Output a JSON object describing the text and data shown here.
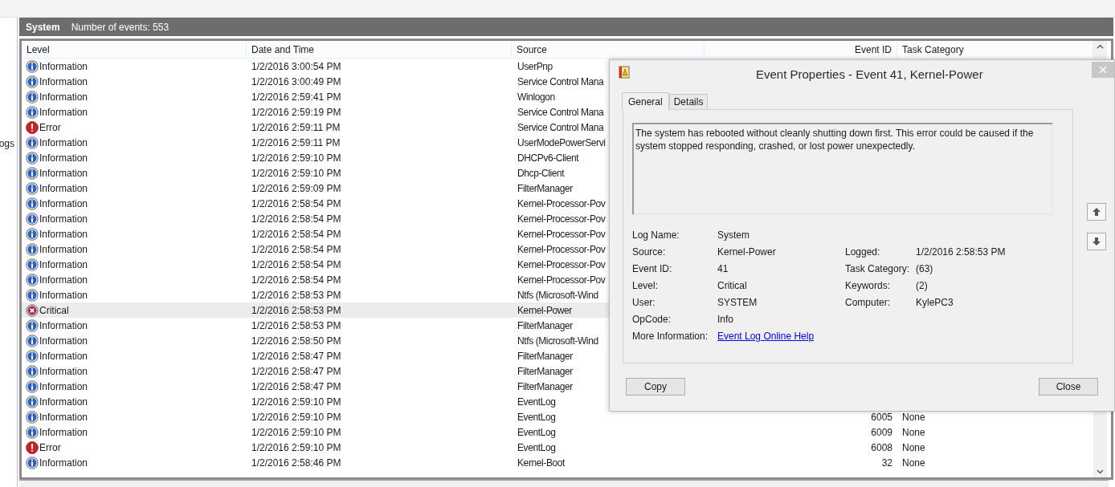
{
  "sidebar": {
    "partial_text": "ogs"
  },
  "panel": {
    "title": "System",
    "count": "Number of events: 553"
  },
  "table": {
    "columns": [
      "Level",
      "Date and Time",
      "Source",
      "Event ID",
      "Task Category"
    ],
    "rows": [
      {
        "kind": "info",
        "level": "Information",
        "date": "1/2/2016 3:00:54 PM",
        "source": "UserPnp",
        "selected": false
      },
      {
        "kind": "info",
        "level": "Information",
        "date": "1/2/2016 3:00:49 PM",
        "source": "Service Control Mana",
        "selected": false
      },
      {
        "kind": "info",
        "level": "Information",
        "date": "1/2/2016 2:59:41 PM",
        "source": "Winlogon",
        "selected": false
      },
      {
        "kind": "info",
        "level": "Information",
        "date": "1/2/2016 2:59:19 PM",
        "source": "Service Control Mana",
        "selected": false
      },
      {
        "kind": "error",
        "level": "Error",
        "date": "1/2/2016 2:59:11 PM",
        "source": "Service Control Mana",
        "selected": false
      },
      {
        "kind": "info",
        "level": "Information",
        "date": "1/2/2016 2:59:11 PM",
        "source": "UserModePowerServi",
        "selected": false
      },
      {
        "kind": "info",
        "level": "Information",
        "date": "1/2/2016 2:59:10 PM",
        "source": "DHCPv6-Client",
        "selected": false
      },
      {
        "kind": "info",
        "level": "Information",
        "date": "1/2/2016 2:59:10 PM",
        "source": "Dhcp-Client",
        "selected": false
      },
      {
        "kind": "info",
        "level": "Information",
        "date": "1/2/2016 2:59:09 PM",
        "source": "FilterManager",
        "selected": false
      },
      {
        "kind": "info",
        "level": "Information",
        "date": "1/2/2016 2:58:54 PM",
        "source": "Kernel-Processor-Pov",
        "selected": false
      },
      {
        "kind": "info",
        "level": "Information",
        "date": "1/2/2016 2:58:54 PM",
        "source": "Kernel-Processor-Pov",
        "selected": false
      },
      {
        "kind": "info",
        "level": "Information",
        "date": "1/2/2016 2:58:54 PM",
        "source": "Kernel-Processor-Pov",
        "selected": false
      },
      {
        "kind": "info",
        "level": "Information",
        "date": "1/2/2016 2:58:54 PM",
        "source": "Kernel-Processor-Pov",
        "selected": false
      },
      {
        "kind": "info",
        "level": "Information",
        "date": "1/2/2016 2:58:54 PM",
        "source": "Kernel-Processor-Pov",
        "selected": false
      },
      {
        "kind": "info",
        "level": "Information",
        "date": "1/2/2016 2:58:54 PM",
        "source": "Kernel-Processor-Pov",
        "selected": false
      },
      {
        "kind": "info",
        "level": "Information",
        "date": "1/2/2016 2:58:53 PM",
        "source": "Ntfs (Microsoft-Wind",
        "selected": false
      },
      {
        "kind": "critical",
        "level": "Critical",
        "date": "1/2/2016 2:58:53 PM",
        "source": "Kernel-Power",
        "selected": true
      },
      {
        "kind": "info",
        "level": "Information",
        "date": "1/2/2016 2:58:53 PM",
        "source": "FilterManager",
        "selected": false
      },
      {
        "kind": "info",
        "level": "Information",
        "date": "1/2/2016 2:58:50 PM",
        "source": "Ntfs (Microsoft-Wind",
        "selected": false
      },
      {
        "kind": "info",
        "level": "Information",
        "date": "1/2/2016 2:58:47 PM",
        "source": "FilterManager",
        "selected": false
      },
      {
        "kind": "info",
        "level": "Information",
        "date": "1/2/2016 2:58:47 PM",
        "source": "FilterManager",
        "selected": false
      },
      {
        "kind": "info",
        "level": "Information",
        "date": "1/2/2016 2:58:47 PM",
        "source": "FilterManager",
        "selected": false
      },
      {
        "kind": "info",
        "level": "Information",
        "date": "1/2/2016 2:59:10 PM",
        "source": "EventLog",
        "selected": false
      },
      {
        "kind": "info",
        "level": "Information",
        "date": "1/2/2016 2:59:10 PM",
        "source": "EventLog",
        "event_id": "6005",
        "category": "None",
        "selected": false
      },
      {
        "kind": "info",
        "level": "Information",
        "date": "1/2/2016 2:59:10 PM",
        "source": "EventLog",
        "event_id": "6009",
        "category": "None",
        "selected": false
      },
      {
        "kind": "error",
        "level": "Error",
        "date": "1/2/2016 2:59:10 PM",
        "source": "EventLog",
        "event_id": "6008",
        "category": "None",
        "selected": false
      },
      {
        "kind": "info",
        "level": "Information",
        "date": "1/2/2016 2:58:46 PM",
        "source": "Kernel-Boot",
        "event_id": "32",
        "category": "None",
        "selected": false
      }
    ]
  },
  "dialog": {
    "title": "Event Properties - Event 41, Kernel-Power",
    "tabs": [
      {
        "label": "General",
        "selected": true
      },
      {
        "label": "Details",
        "selected": false
      }
    ],
    "message": "The system has rebooted without cleanly shutting down first. This error could be caused if the system stopped responding, crashed, or lost power unexpectedly.",
    "left_fields": [
      {
        "kind": "text",
        "label": "Log Name:",
        "value": "System"
      },
      {
        "kind": "text",
        "label": "Source:",
        "value": "Kernel-Power"
      },
      {
        "kind": "text",
        "label": "Event ID:",
        "value": "41"
      },
      {
        "kind": "text",
        "label": "Level:",
        "value": "Critical"
      },
      {
        "kind": "text",
        "label": "User:",
        "value": "SYSTEM"
      },
      {
        "kind": "text",
        "label": "OpCode:",
        "value": "Info"
      },
      {
        "kind": "link",
        "label": "More Information:",
        "value": "Event Log Online Help"
      }
    ],
    "right_fields": [
      {
        "label": "Logged:",
        "value": "1/2/2016 2:58:53 PM"
      },
      {
        "label": "Task Category:",
        "value": "(63)"
      },
      {
        "label": "Keywords:",
        "value": "(2)"
      },
      {
        "label": "Computer:",
        "value": "KylePC3"
      }
    ],
    "buttons": [
      "Copy",
      "Close"
    ]
  }
}
